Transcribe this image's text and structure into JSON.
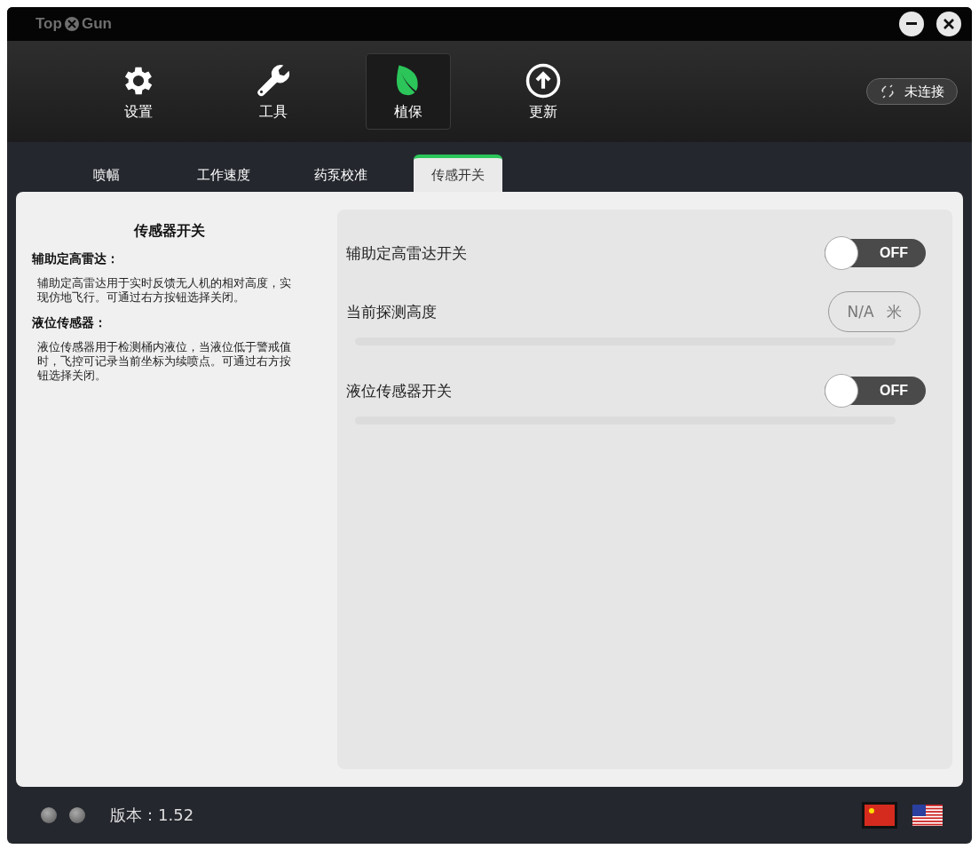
{
  "title_bar": {
    "logo_left": "Top",
    "logo_right": "Gun"
  },
  "nav": [
    {
      "label": "设置",
      "kind": "gear",
      "selected": false
    },
    {
      "label": "工具",
      "kind": "wrench",
      "selected": false
    },
    {
      "label": "植保",
      "kind": "leaf",
      "selected": true
    },
    {
      "label": "更新",
      "kind": "upload",
      "selected": false
    }
  ],
  "connection": {
    "label": "未连接",
    "connected": false
  },
  "tabs": [
    {
      "label": "喷幅",
      "selected": false
    },
    {
      "label": "工作速度",
      "selected": false
    },
    {
      "label": "药泵校准",
      "selected": false
    },
    {
      "label": "传感开关",
      "selected": true
    }
  ],
  "help": {
    "title": "传感器开关",
    "sections": [
      {
        "heading": "辅助定高雷达：",
        "body": "辅助定高雷达用于实时反馈无人机的相对高度，实现仿地飞行。可通过右方按钮选择关闭。"
      },
      {
        "heading": "液位传感器：",
        "body": "液位传感器用于检测桶内液位，当液位低于警戒值时，飞控可记录当前坐标为续喷点。可通过右方按钮选择关闭。"
      }
    ]
  },
  "settings": [
    {
      "kind": "toggle",
      "label": "辅助定高雷达开关",
      "on": false,
      "state_text": "OFF"
    },
    {
      "kind": "reading",
      "label": "当前探测高度",
      "value": "N/A",
      "unit": "米"
    },
    {
      "kind": "divider"
    },
    {
      "kind": "toggle",
      "label": "液位传感器开关",
      "on": false,
      "state_text": "OFF"
    },
    {
      "kind": "divider"
    }
  ],
  "status_bar": {
    "indicators": [
      {
        "on": false
      },
      {
        "on": false
      }
    ],
    "version": "版本：1.52",
    "languages": [
      {
        "kind": "cn",
        "selected": true
      },
      {
        "kind": "us",
        "selected": false
      }
    ]
  }
}
